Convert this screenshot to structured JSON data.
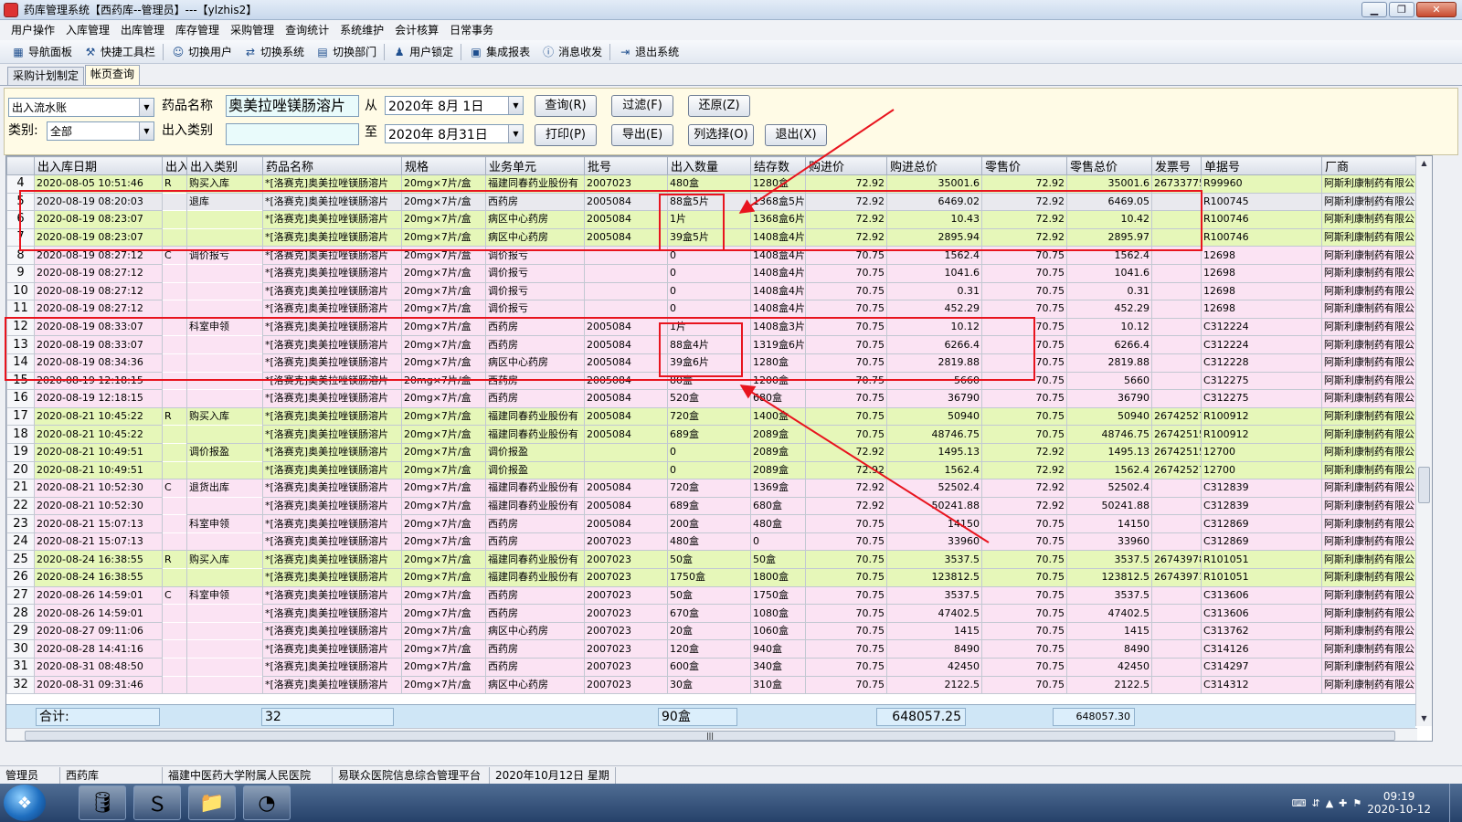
{
  "window": {
    "title": "药库管理系统【西药库--管理员】---【ylzhis2】",
    "min": "▁",
    "max": "❐",
    "close": "✕"
  },
  "menu": [
    "用户操作",
    "入库管理",
    "出库管理",
    "库存管理",
    "采购管理",
    "查询统计",
    "系统维护",
    "会计核算",
    "日常事务"
  ],
  "toolbar": [
    {
      "label": "导航面板",
      "icon": "nav-icon",
      "glyph": "▦"
    },
    {
      "label": "快捷工具栏",
      "icon": "tools-icon",
      "glyph": "⚒"
    },
    {
      "label": "切换用户",
      "icon": "users-icon",
      "glyph": "☺"
    },
    {
      "label": "切换系统",
      "icon": "switch-icon",
      "glyph": "⇄"
    },
    {
      "label": "切换部门",
      "icon": "dept-icon",
      "glyph": "▤"
    },
    {
      "label": "用户锁定",
      "icon": "lock-icon",
      "glyph": "♟"
    },
    {
      "label": "集成报表",
      "icon": "report-icon",
      "glyph": "▣"
    },
    {
      "label": "消息收发",
      "icon": "message-icon",
      "glyph": "ⓘ"
    },
    {
      "label": "退出系统",
      "icon": "exit-icon",
      "glyph": "⇥"
    }
  ],
  "tabs": [
    "采购计划制定",
    "帐页查询"
  ],
  "filter": {
    "ledger": "出入流水账",
    "category_label": "类别:",
    "category": "全部",
    "drug_label": "药品名称",
    "drug": "奥美拉唑镁肠溶片",
    "io_label": "出入类别",
    "io": "",
    "from_label": "从",
    "from": "2020年  8月 1日",
    "to_label": "至",
    "to": "2020年  8月31日",
    "buttons": [
      "查询(R)",
      "过滤(F)",
      "还原(Z)",
      "打印(P)",
      "导出(E)",
      "列选择(O)",
      "退出(X)"
    ]
  },
  "table": {
    "columns": [
      "",
      "出入库日期",
      "出入",
      "出入类别",
      "药品名称",
      "规格",
      "业务单元",
      "批号",
      "出入数量",
      "结存数",
      "购进价",
      "购进总价",
      "零售价",
      "零售总价",
      "发票号",
      "单据号",
      "厂商"
    ],
    "rows": [
      [
        "4",
        "2020-08-05 10:51:46",
        "R",
        "购买入库",
        "*[洛赛克]奥美拉唑镁肠溶片",
        "20mg×7片/盒",
        "福建同春药业股份有",
        "2007023",
        "480盒",
        "1280盒",
        "72.92",
        "35001.6",
        "72.92",
        "35001.6",
        "26733775",
        "R99960",
        "阿斯利康制药有限公司"
      ],
      [
        "5",
        "2020-08-19 08:20:03",
        "",
        "退库",
        "*[洛赛克]奥美拉唑镁肠溶片",
        "20mg×7片/盒",
        "西药房",
        "2005084",
        "88盒5片",
        "1368盒5片",
        "72.92",
        "6469.02",
        "72.92",
        "6469.05",
        "",
        "R100745",
        "阿斯利康制药有限公司"
      ],
      [
        "6",
        "2020-08-19 08:23:07",
        "",
        "",
        "*[洛赛克]奥美拉唑镁肠溶片",
        "20mg×7片/盒",
        "病区中心药房",
        "2005084",
        "1片",
        "1368盒6片",
        "72.92",
        "10.43",
        "72.92",
        "10.42",
        "",
        "R100746",
        "阿斯利康制药有限公司"
      ],
      [
        "7",
        "2020-08-19 08:23:07",
        "",
        "",
        "*[洛赛克]奥美拉唑镁肠溶片",
        "20mg×7片/盒",
        "病区中心药房",
        "2005084",
        "39盒5片",
        "1408盒4片",
        "72.92",
        "2895.94",
        "72.92",
        "2895.97",
        "",
        "R100746",
        "阿斯利康制药有限公司"
      ],
      [
        "8",
        "2020-08-19 08:27:12",
        "C",
        "调价报亏",
        "*[洛赛克]奥美拉唑镁肠溶片",
        "20mg×7片/盒",
        "调价报亏",
        "",
        "0",
        "1408盒4片",
        "70.75",
        "1562.4",
        "70.75",
        "1562.4",
        "",
        "12698",
        "阿斯利康制药有限公司"
      ],
      [
        "9",
        "2020-08-19 08:27:12",
        "",
        "",
        "*[洛赛克]奥美拉唑镁肠溶片",
        "20mg×7片/盒",
        "调价报亏",
        "",
        "0",
        "1408盒4片",
        "70.75",
        "1041.6",
        "70.75",
        "1041.6",
        "",
        "12698",
        "阿斯利康制药有限公司"
      ],
      [
        "10",
        "2020-08-19 08:27:12",
        "",
        "",
        "*[洛赛克]奥美拉唑镁肠溶片",
        "20mg×7片/盒",
        "调价报亏",
        "",
        "0",
        "1408盒4片",
        "70.75",
        "0.31",
        "70.75",
        "0.31",
        "",
        "12698",
        "阿斯利康制药有限公司"
      ],
      [
        "11",
        "2020-08-19 08:27:12",
        "",
        "",
        "*[洛赛克]奥美拉唑镁肠溶片",
        "20mg×7片/盒",
        "调价报亏",
        "",
        "0",
        "1408盒4片",
        "70.75",
        "452.29",
        "70.75",
        "452.29",
        "",
        "12698",
        "阿斯利康制药有限公司"
      ],
      [
        "12",
        "2020-08-19 08:33:07",
        "",
        "科室申领",
        "*[洛赛克]奥美拉唑镁肠溶片",
        "20mg×7片/盒",
        "西药房",
        "2005084",
        "1片",
        "1408盒3片",
        "70.75",
        "10.12",
        "70.75",
        "10.12",
        "",
        "C312224",
        "阿斯利康制药有限公司"
      ],
      [
        "13",
        "2020-08-19 08:33:07",
        "",
        "",
        "*[洛赛克]奥美拉唑镁肠溶片",
        "20mg×7片/盒",
        "西药房",
        "2005084",
        "88盒4片",
        "1319盒6片",
        "70.75",
        "6266.4",
        "70.75",
        "6266.4",
        "",
        "C312224",
        "阿斯利康制药有限公司"
      ],
      [
        "14",
        "2020-08-19 08:34:36",
        "",
        "",
        "*[洛赛克]奥美拉唑镁肠溶片",
        "20mg×7片/盒",
        "病区中心药房",
        "2005084",
        "39盒6片",
        "1280盒",
        "70.75",
        "2819.88",
        "70.75",
        "2819.88",
        "",
        "C312228",
        "阿斯利康制药有限公司"
      ],
      [
        "15",
        "2020-08-19 12:18:15",
        "",
        "",
        "*[洛赛克]奥美拉唑镁肠溶片",
        "20mg×7片/盒",
        "西药房",
        "2005084",
        "80盒",
        "1200盒",
        "70.75",
        "5660",
        "70.75",
        "5660",
        "",
        "C312275",
        "阿斯利康制药有限公司"
      ],
      [
        "16",
        "2020-08-19 12:18:15",
        "",
        "",
        "*[洛赛克]奥美拉唑镁肠溶片",
        "20mg×7片/盒",
        "西药房",
        "2005084",
        "520盒",
        "680盒",
        "70.75",
        "36790",
        "70.75",
        "36790",
        "",
        "C312275",
        "阿斯利康制药有限公司"
      ],
      [
        "17",
        "2020-08-21 10:45:22",
        "R",
        "购买入库",
        "*[洛赛克]奥美拉唑镁肠溶片",
        "20mg×7片/盒",
        "福建同春药业股份有",
        "2005084",
        "720盒",
        "1400盒",
        "70.75",
        "50940",
        "70.75",
        "50940",
        "26742527",
        "R100912",
        "阿斯利康制药有限公司"
      ],
      [
        "18",
        "2020-08-21 10:45:22",
        "",
        "",
        "*[洛赛克]奥美拉唑镁肠溶片",
        "20mg×7片/盒",
        "福建同春药业股份有",
        "2005084",
        "689盒",
        "2089盒",
        "70.75",
        "48746.75",
        "70.75",
        "48746.75",
        "26742515",
        "R100912",
        "阿斯利康制药有限公司"
      ],
      [
        "19",
        "2020-08-21 10:49:51",
        "",
        "调价报盈",
        "*[洛赛克]奥美拉唑镁肠溶片",
        "20mg×7片/盒",
        "调价报盈",
        "",
        "0",
        "2089盒",
        "72.92",
        "1495.13",
        "72.92",
        "1495.13",
        "26742515",
        "12700",
        "阿斯利康制药有限公司"
      ],
      [
        "20",
        "2020-08-21 10:49:51",
        "",
        "",
        "*[洛赛克]奥美拉唑镁肠溶片",
        "20mg×7片/盒",
        "调价报盈",
        "",
        "0",
        "2089盒",
        "72.92",
        "1562.4",
        "72.92",
        "1562.4",
        "26742527",
        "12700",
        "阿斯利康制药有限公司"
      ],
      [
        "21",
        "2020-08-21 10:52:30",
        "C",
        "退货出库",
        "*[洛赛克]奥美拉唑镁肠溶片",
        "20mg×7片/盒",
        "福建同春药业股份有",
        "2005084",
        "720盒",
        "1369盒",
        "72.92",
        "52502.4",
        "72.92",
        "52502.4",
        "",
        "C312839",
        "阿斯利康制药有限公司"
      ],
      [
        "22",
        "2020-08-21 10:52:30",
        "",
        "",
        "*[洛赛克]奥美拉唑镁肠溶片",
        "20mg×7片/盒",
        "福建同春药业股份有",
        "2005084",
        "689盒",
        "680盒",
        "72.92",
        "50241.88",
        "72.92",
        "50241.88",
        "",
        "C312839",
        "阿斯利康制药有限公司"
      ],
      [
        "23",
        "2020-08-21 15:07:13",
        "",
        "科室申领",
        "*[洛赛克]奥美拉唑镁肠溶片",
        "20mg×7片/盒",
        "西药房",
        "2005084",
        "200盒",
        "480盒",
        "70.75",
        "14150",
        "70.75",
        "14150",
        "",
        "C312869",
        "阿斯利康制药有限公司"
      ],
      [
        "24",
        "2020-08-21 15:07:13",
        "",
        "",
        "*[洛赛克]奥美拉唑镁肠溶片",
        "20mg×7片/盒",
        "西药房",
        "2007023",
        "480盒",
        "0",
        "70.75",
        "33960",
        "70.75",
        "33960",
        "",
        "C312869",
        "阿斯利康制药有限公司"
      ],
      [
        "25",
        "2020-08-24 16:38:55",
        "R",
        "购买入库",
        "*[洛赛克]奥美拉唑镁肠溶片",
        "20mg×7片/盒",
        "福建同春药业股份有",
        "2007023",
        "50盒",
        "50盒",
        "70.75",
        "3537.5",
        "70.75",
        "3537.5",
        "26743978",
        "R101051",
        "阿斯利康制药有限公司"
      ],
      [
        "26",
        "2020-08-24 16:38:55",
        "",
        "",
        "*[洛赛克]奥美拉唑镁肠溶片",
        "20mg×7片/盒",
        "福建同春药业股份有",
        "2007023",
        "1750盒",
        "1800盒",
        "70.75",
        "123812.5",
        "70.75",
        "123812.5",
        "26743971",
        "R101051",
        "阿斯利康制药有限公司"
      ],
      [
        "27",
        "2020-08-26 14:59:01",
        "C",
        "科室申领",
        "*[洛赛克]奥美拉唑镁肠溶片",
        "20mg×7片/盒",
        "西药房",
        "2007023",
        "50盒",
        "1750盒",
        "70.75",
        "3537.5",
        "70.75",
        "3537.5",
        "",
        "C313606",
        "阿斯利康制药有限公司"
      ],
      [
        "28",
        "2020-08-26 14:59:01",
        "",
        "",
        "*[洛赛克]奥美拉唑镁肠溶片",
        "20mg×7片/盒",
        "西药房",
        "2007023",
        "670盒",
        "1080盒",
        "70.75",
        "47402.5",
        "70.75",
        "47402.5",
        "",
        "C313606",
        "阿斯利康制药有限公司"
      ],
      [
        "29",
        "2020-08-27 09:11:06",
        "",
        "",
        "*[洛赛克]奥美拉唑镁肠溶片",
        "20mg×7片/盒",
        "病区中心药房",
        "2007023",
        "20盒",
        "1060盒",
        "70.75",
        "1415",
        "70.75",
        "1415",
        "",
        "C313762",
        "阿斯利康制药有限公司"
      ],
      [
        "30",
        "2020-08-28 14:41:16",
        "",
        "",
        "*[洛赛克]奥美拉唑镁肠溶片",
        "20mg×7片/盒",
        "西药房",
        "2007023",
        "120盒",
        "940盒",
        "70.75",
        "8490",
        "70.75",
        "8490",
        "",
        "C314126",
        "阿斯利康制药有限公司"
      ],
      [
        "31",
        "2020-08-31 08:48:50",
        "",
        "",
        "*[洛赛克]奥美拉唑镁肠溶片",
        "20mg×7片/盒",
        "西药房",
        "2007023",
        "600盒",
        "340盒",
        "70.75",
        "42450",
        "70.75",
        "42450",
        "",
        "C314297",
        "阿斯利康制药有限公司"
      ],
      [
        "32",
        "2020-08-31 09:31:46",
        "",
        "",
        "*[洛赛克]奥美拉唑镁肠溶片",
        "20mg×7片/盒",
        "病区中心药房",
        "2007023",
        "30盒",
        "310盒",
        "70.75",
        "2122.5",
        "70.75",
        "2122.5",
        "",
        "C314312",
        "阿斯利康制药有限公司"
      ]
    ],
    "row_colors": [
      "green",
      "gray",
      "green",
      "green",
      "pink",
      "pink",
      "pink",
      "pink",
      "pink",
      "pink",
      "pink",
      "pink",
      "pink",
      "green",
      "green",
      "green",
      "green",
      "pink",
      "pink",
      "pink",
      "pink",
      "green",
      "green",
      "pink",
      "pink",
      "pink",
      "pink",
      "pink",
      "pink"
    ]
  },
  "summary": {
    "label": "合计:",
    "count": "32",
    "qty": "90盒",
    "purchase_total": "648057.25",
    "retail_total": "648057.30"
  },
  "status": [
    "管理员",
    "西药库",
    "福建中医药大学附属人民医院",
    "易联众医院信息综合管理平台",
    "2020年10月12日  星期一"
  ],
  "taskbar": {
    "time": "09:19",
    "date": "2020-10-12"
  },
  "colors": {
    "annotation": "#e8141e",
    "green_row": "#e6f7b9",
    "pink_row": "#fbe3f3",
    "panel": "#fffbe6"
  }
}
